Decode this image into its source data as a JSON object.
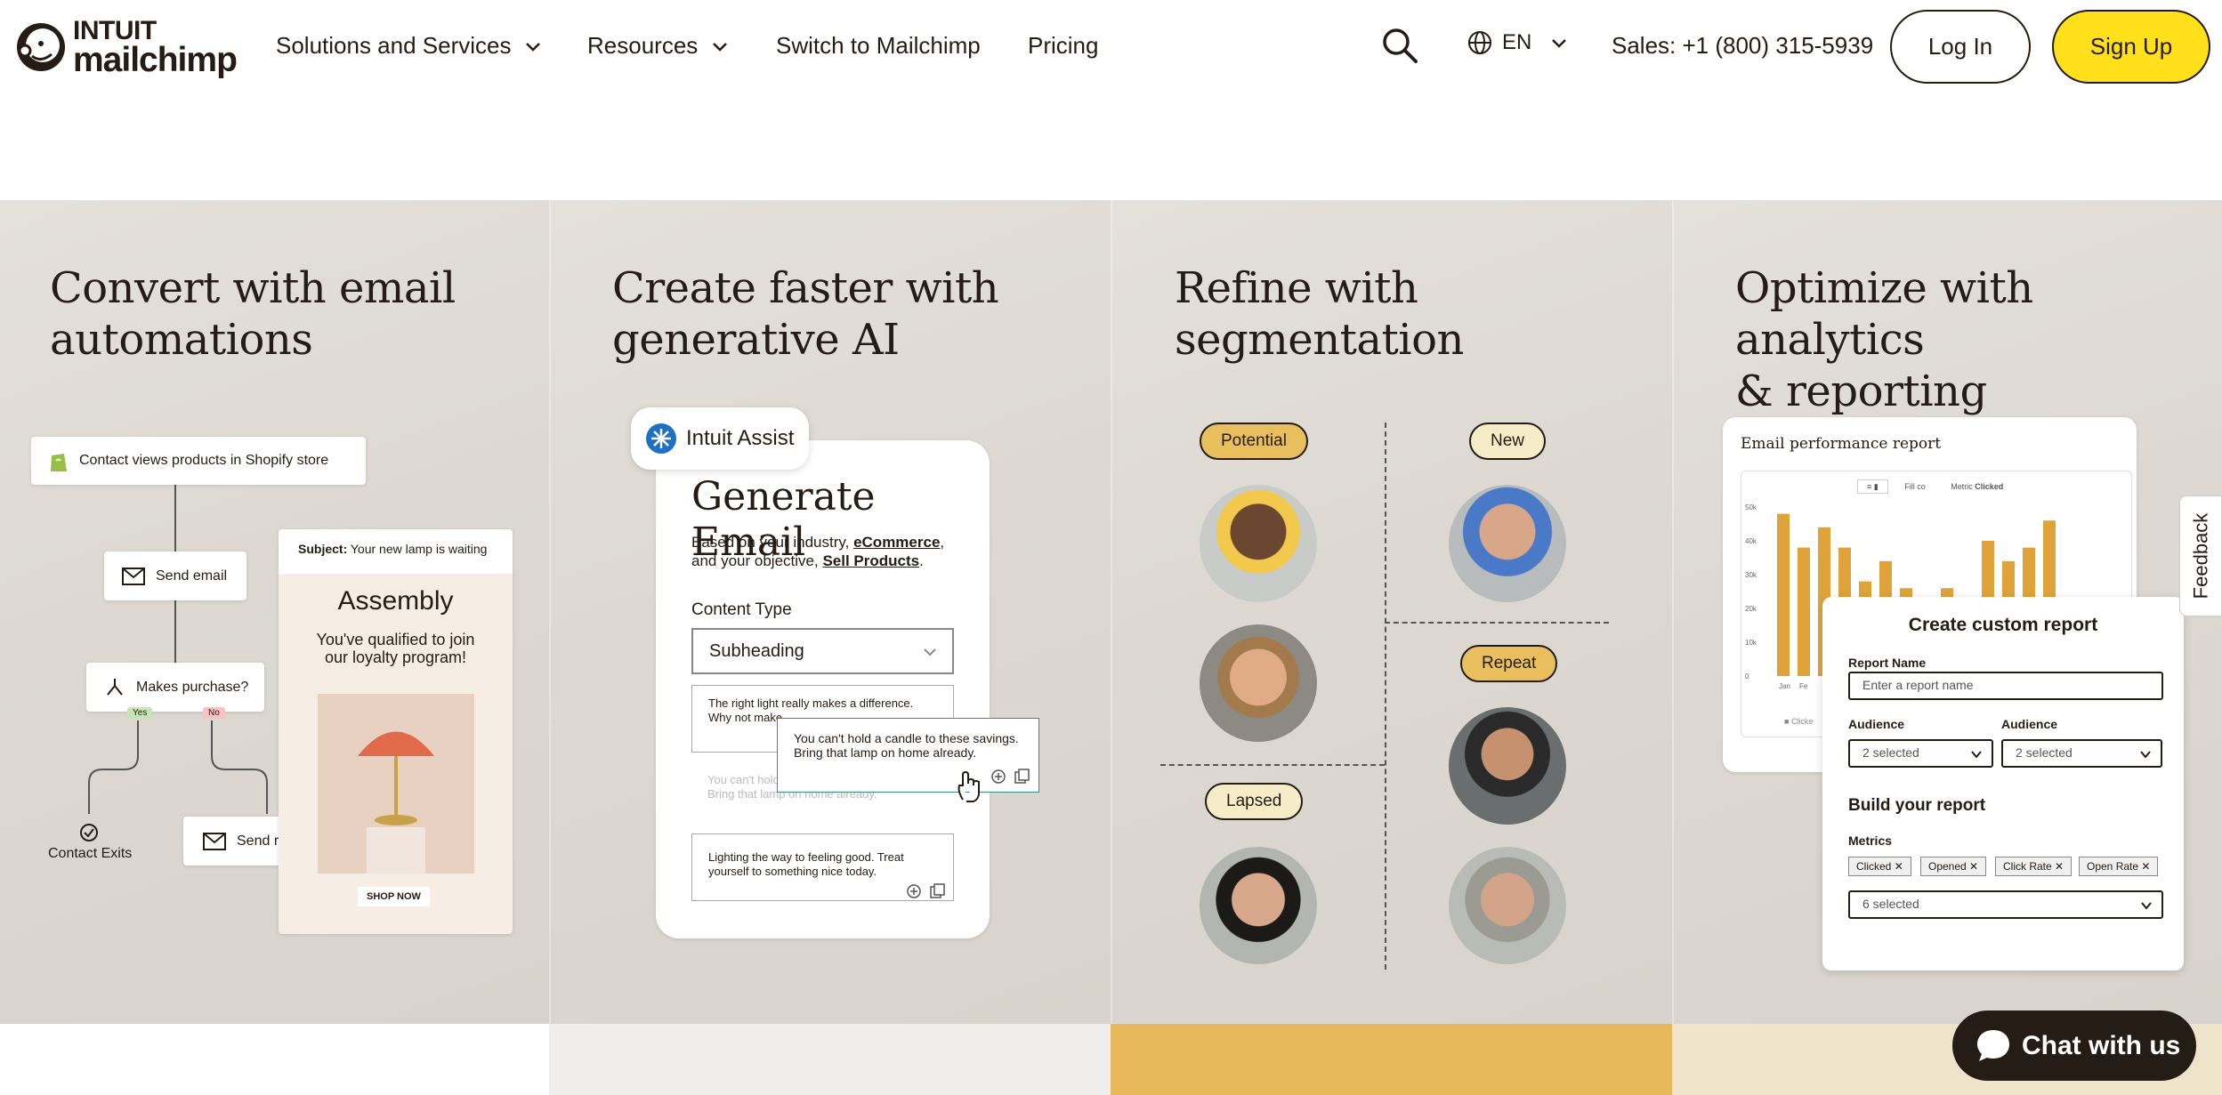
{
  "brand": {
    "intuit": "INTUIT",
    "name": "mailchimp"
  },
  "nav": {
    "solutions": "Solutions and Services",
    "resources": "Resources",
    "switch": "Switch to Mailchimp",
    "pricing": "Pricing",
    "language": "EN",
    "sales": "Sales: +1 (800) 315-5939",
    "login": "Log In",
    "signup": "Sign Up"
  },
  "panels": [
    {
      "title_line1": "Convert with email",
      "title_line2": "automations"
    },
    {
      "title_line1": "Create faster with",
      "title_line2": "generative AI"
    },
    {
      "title_line1": "Refine with",
      "title_line2": "segmentation"
    },
    {
      "title_line1": "Optimize with analytics",
      "title_line2": "& reporting"
    }
  ],
  "automation": {
    "trigger": "Contact views products in Shopify store",
    "send_email": "Send email",
    "condition": "Makes purchase?",
    "yes": "Yes",
    "no": "No",
    "exit": "Contact Exits",
    "reminder": "Send reminder",
    "email_subject_label": "Subject:",
    "email_subject": "Your new lamp is waiting",
    "email_heading": "Assembly",
    "email_body": "You've qualified to join our loyalty program!",
    "email_cta": "SHOP NOW"
  },
  "ai": {
    "badge": "Intuit Assist",
    "heading": "Generate Email",
    "desc_prefix": "Based on your industry,",
    "industry": "eCommerce",
    "desc_mid": "and your objective,",
    "objective": "Sell Products",
    "content_type_label": "Content Type",
    "content_type_value": "Subheading",
    "option1": "The right light really makes a difference. Why not make",
    "option2": "You can't hold a candle to these savings. Bring that lamp on home already.",
    "option3": "Lighting the way to feeling good. Treat yourself to something nice today.",
    "popup": "You can't hold a candle to these savings. Bring that lamp on home already."
  },
  "segments": {
    "potential": "Potential",
    "new": "New",
    "repeat": "Repeat",
    "lapsed": "Lapsed"
  },
  "report": {
    "title": "Email performance report",
    "toolbar_fill": "Fill co",
    "toolbar_metric": "Metric",
    "toolbar_metric_value": "Clicked",
    "y_ticks": [
      "50k",
      "40k",
      "30k",
      "20k",
      "10k",
      "0"
    ],
    "x_first": "Jan",
    "x_second": "Fe",
    "legend": "Clicke",
    "custom_title": "Create custom report",
    "report_name_label": "Report Name",
    "report_name_placeholder": "Enter a report name",
    "audience_label": "Audience",
    "audience_value": "2 selected",
    "build_title": "Build your report",
    "metrics_label": "Metrics",
    "metric_tags": [
      "Clicked",
      "Opened",
      "Click Rate",
      "Open Rate"
    ],
    "metrics_selected": "6 selected",
    "bars": [
      48,
      38,
      44,
      38,
      28,
      34,
      26,
      20,
      26,
      18,
      40,
      34,
      38,
      46
    ],
    "bar_color": "#e0a339"
  },
  "colors": {
    "accent": "#ffe01b",
    "ink": "#241c15",
    "segment_pill": "#e9be5c"
  },
  "chat": "Chat with us",
  "feedback": "Feedback"
}
